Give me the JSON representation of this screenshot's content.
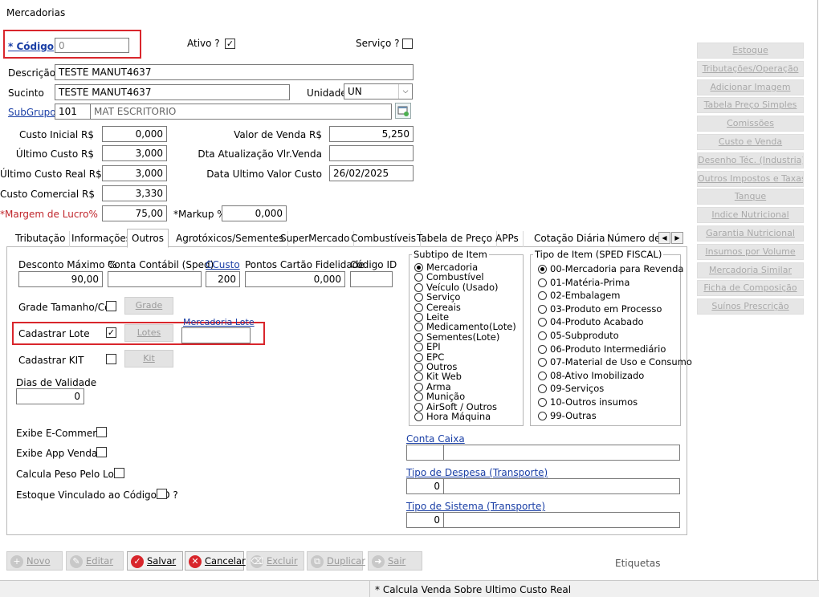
{
  "window": {
    "title": "Mercadorias"
  },
  "header": {
    "codigo_label": "* Código",
    "codigo_value": "0",
    "ativo_label": "Ativo ?",
    "ativo_checked": "✓",
    "servico_label": "Serviço ?"
  },
  "fields": {
    "descricao_label": "Descrição",
    "descricao_value": "TESTE MANUT4637",
    "sucinto_label": "Sucinto",
    "sucinto_value": "TESTE MANUT4637",
    "unidade_label": "Unidade",
    "unidade_value": "UN",
    "subgrupo_label": "SubGrupo",
    "subgrupo_code": "101",
    "subgrupo_name": "MAT ESCRITORIO",
    "custo_inicial_label": "Custo Inicial R$",
    "custo_inicial_value": "0,000",
    "ultimo_custo_label": "Último Custo R$",
    "ultimo_custo_value": "3,000",
    "ultimo_custo_real_label": "Último Custo Real R$",
    "ultimo_custo_real_value": "3,000",
    "custo_comercial_label": "Custo Comercial R$",
    "custo_comercial_value": "3,330",
    "margem_label": "*Margem de Lucro%",
    "margem_value": "75,00",
    "markup_label": "*Markup %",
    "markup_value": "0,000",
    "valor_venda_label": "Valor de Venda R$",
    "valor_venda_value": "5,250",
    "dta_atualizacao_label": "Dta Atualização Vlr.Venda",
    "dta_atualizacao_value": "",
    "data_ultimo_custo_label": "Data Ultimo Valor Custo",
    "data_ultimo_custo_value": "26/02/2025"
  },
  "tabs": [
    "Tributação",
    "Informações",
    "Outros",
    "Agrotóxicos/Sementes",
    "SuperMercado",
    "Combustíveis",
    "Tabela de Preço",
    "APPs",
    "Cotação Diária",
    "Número de S"
  ],
  "active_tab": "Outros",
  "outros": {
    "desconto_label": "Desconto Máximo %",
    "desconto_value": "90,00",
    "conta_contabil_label": "Conta Contábil (Sped)",
    "ccusto_label": "CCusto",
    "ccusto_value": "200",
    "pontos_label": "Pontos Cartão Fidelidade",
    "pontos_value": "0,000",
    "codigo_id_label": "Código ID",
    "grade_label": "Grade Tamanho/Cor",
    "grade_button": "Grade",
    "cadastrar_lote_label": "Cadastrar Lote",
    "cadastrar_lote_checked": "✓",
    "lotes_button": "Lotes",
    "mercadoria_lote_label": "Mercadoria Lote",
    "cadastrar_kit_label": "Cadastrar KIT",
    "kit_button": "Kit",
    "dias_validade_label": "Dias de Validade",
    "dias_validade_value": "0",
    "exibe_ecommerce_label": "Exibe E-Commerce",
    "exibe_app_label": "Exibe App Venda",
    "calcula_peso_label": "Calcula Peso Pelo Lote",
    "estoque_vinculado_label": "Estoque Vinculado ao Código ID ?"
  },
  "subtipo": {
    "title": "Subtipo de Item",
    "options": [
      "Mercadoria",
      "Combustível",
      "Veículo (Usado)",
      "Serviço",
      "Cereais",
      "Leite",
      "Medicamento(Lote)",
      "Sementes(Lote)",
      "EPI",
      "EPC",
      "Outros",
      "Kit Web",
      "Arma",
      "Munição",
      "AirSoft / Outros",
      "Hora Máquina"
    ]
  },
  "tipo_item": {
    "title": "Tipo de Item (SPED FISCAL)",
    "options": [
      "00-Mercadoria para Revenda",
      "01-Matéria-Prima",
      "02-Embalagem",
      "03-Produto em Processo",
      "04-Produto Acabado",
      "05-Subproduto",
      "06-Produto Intermediário",
      "07-Material de Uso e Consumo",
      "08-Ativo Imobilizado",
      "09-Serviços",
      "10-Outros insumos",
      "99-Outras"
    ]
  },
  "conta_caixa": {
    "label": "Conta Caixa"
  },
  "tipo_despesa": {
    "label": "Tipo de Despesa (Transporte)",
    "value": "0"
  },
  "tipo_sistema": {
    "label": "Tipo de Sistema (Transporte)",
    "value": "0"
  },
  "right_buttons": [
    "Estoque",
    "Tributações/Operação",
    "Adicionar Imagem",
    "Tabela Preço Simples",
    "Comissões",
    "Custo e Venda",
    "Desenho Téc. (Industria)",
    "Outros Impostos e Taxas",
    "Tanque",
    "Indice Nutricional",
    "Garantia Nutricional",
    "Insumos por Volume",
    "Mercadoria Similar",
    "Ficha de Composição",
    "Suínos Prescrição"
  ],
  "bottom_buttons": {
    "novo": "Novo",
    "editar": "Editar",
    "salvar": "Salvar",
    "cancelar": "Cancelar",
    "excluir": "Excluir",
    "duplicar": "Duplicar",
    "sair": "Sair"
  },
  "etiquetas": "Etiquetas",
  "status_bar": "* Calcula Venda Sobre Ultimo Custo  Real"
}
